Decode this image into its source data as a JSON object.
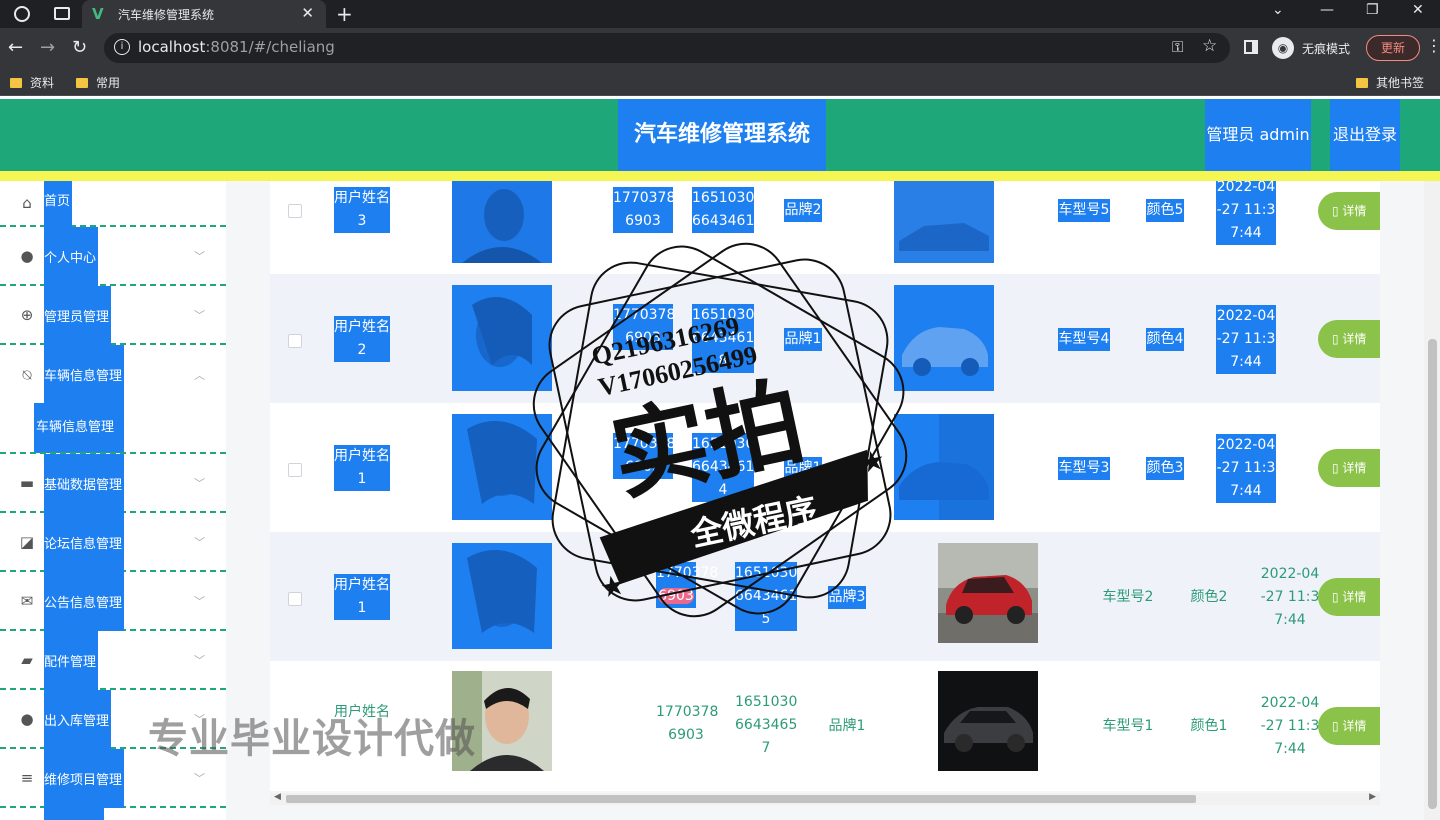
{
  "browser": {
    "tab_title": "汽车维修管理系统",
    "url_host": "localhost",
    "url_rest": ":8081/#/cheliang",
    "incognito_label": "无痕模式",
    "update_label": "更新",
    "bookmarks": [
      "资料",
      "常用"
    ],
    "other_bookmarks": "其他书签"
  },
  "header": {
    "title": "汽车维修管理系统",
    "user_label": "管理员 admin",
    "logout_label": "退出登录"
  },
  "sidebar": {
    "items": [
      {
        "label": "首页",
        "icon": "home-icon"
      },
      {
        "label": "个人中心",
        "icon": "user-icon"
      },
      {
        "label": "管理员管理",
        "icon": "crosshair-icon"
      },
      {
        "label": "车辆信息管理",
        "icon": "bell-off-icon"
      },
      {
        "label": "基础数据管理",
        "icon": "monitor-icon"
      },
      {
        "label": "论坛信息管理",
        "icon": "chart-icon"
      },
      {
        "label": "公告信息管理",
        "icon": "mail-icon"
      },
      {
        "label": "配件管理",
        "icon": "wallet-icon"
      },
      {
        "label": "出入库管理",
        "icon": "user-icon"
      },
      {
        "label": "维修项目管理",
        "icon": "list-icon"
      }
    ],
    "sub_item": "车辆信息管理"
  },
  "table": {
    "detail_label": "详情",
    "rows": [
      {
        "name": [
          "用户姓名",
          "3"
        ],
        "phone": [
          "1770378",
          "6903"
        ],
        "idno": [
          "1651030",
          "6643461"
        ],
        "brand": "品牌2",
        "model": "车型号5",
        "color": "颜色5",
        "time": [
          "2022-04",
          "-27 11:3",
          "7:44"
        ]
      },
      {
        "name": [
          "用户姓名",
          "2"
        ],
        "phone": [
          "1770378",
          "6903"
        ],
        "idno": [
          "1651030",
          "6643461",
          "8"
        ],
        "brand": "品牌1",
        "model": "车型号4",
        "color": "颜色4",
        "time": [
          "2022-04",
          "-27 11:3",
          "7:44"
        ]
      },
      {
        "name": [
          "用户姓名",
          "1"
        ],
        "phone": [
          "1770378",
          "6903"
        ],
        "idno": [
          "1651030",
          "6643461",
          "4"
        ],
        "brand": "品牌1",
        "model": "车型号3",
        "color": "颜色3",
        "time": [
          "2022-04",
          "-27 11:3",
          "7:44"
        ]
      },
      {
        "name": [
          "用户姓名",
          "1"
        ],
        "phone": [
          "1770378",
          "6903"
        ],
        "idno": [
          "1651030",
          "6643461",
          "5"
        ],
        "brand": "品牌3",
        "model": "车型号2",
        "color": "颜色2",
        "time": [
          "2022-04",
          "-27 11:3",
          "7:44"
        ]
      },
      {
        "name": [
          "用户姓名",
          ""
        ],
        "phone": [
          "1770378",
          "6903"
        ],
        "idno": [
          "1651030",
          "6643465",
          "7"
        ],
        "brand": "品牌1",
        "model": "车型号1",
        "color": "颜色1",
        "time": [
          "2022-04",
          "-27 11:3",
          "7:44"
        ]
      }
    ]
  },
  "watermark": {
    "contact_1": "Q2196316269",
    "contact_2": "V17060256499",
    "stamp_main": "实拍",
    "stamp_banner": "全微程序",
    "bottom_text": "专业毕业设计代做"
  }
}
